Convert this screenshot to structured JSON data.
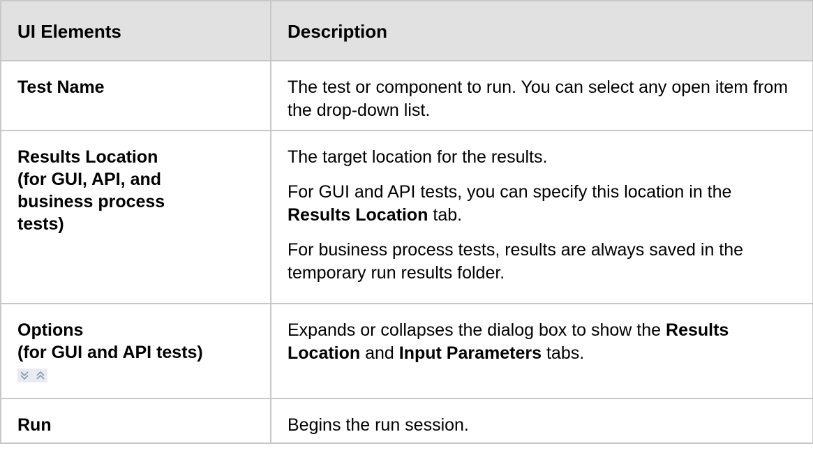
{
  "table": {
    "headers": {
      "col1": "UI Elements",
      "col2": "Description"
    },
    "rows": [
      {
        "label_lines": [
          "Test Name"
        ],
        "description": [
          [
            "The test or component to run. You can select any open item from the drop-down list."
          ]
        ]
      },
      {
        "label_lines": [
          "Results Location",
          "(for GUI, API, and",
          "business process",
          "tests)"
        ],
        "description": [
          [
            "The target location for the results."
          ],
          [
            "For GUI and API tests, you can specify this location in the ",
            "Results Location",
            " tab."
          ],
          [
            "For business process tests, results are always saved in the temporary run results folder."
          ]
        ]
      },
      {
        "label_lines": [
          "Options",
          "(for GUI and API tests)"
        ],
        "icons": [
          "expand-down-icon",
          "collapse-up-icon"
        ],
        "description": [
          [
            "Expands or collapses the dialog box to show the ",
            "Results Location",
            " and ",
            "Input Parameters",
            " tabs."
          ]
        ]
      },
      {
        "label_lines": [
          "Run"
        ],
        "description": [
          [
            "Begins the run session."
          ]
        ]
      }
    ]
  },
  "colors": {
    "header_bg": "#e1e1e1",
    "border": "#c8c8c8",
    "icon_bg": "#e8ecf2",
    "icon_stroke": "#8a96a8"
  }
}
